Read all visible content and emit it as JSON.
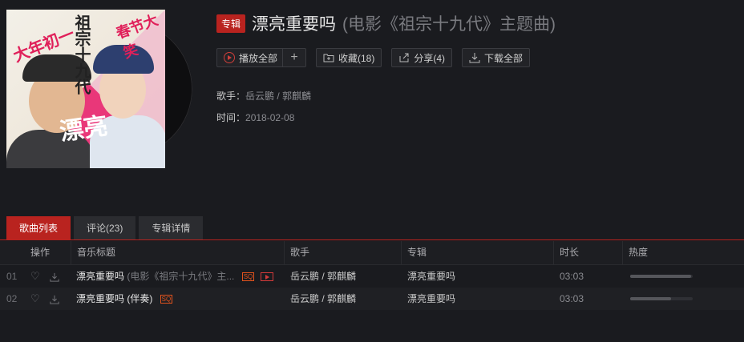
{
  "album": {
    "tag": "专辑",
    "name": "漂亮重要吗",
    "subtitle": "(电影《祖宗十九代》主题曲)",
    "artist_label": "歌手：",
    "artist": "岳云鹏 / 郭麒麟",
    "time_label": "时间：",
    "date": "2018-02-08",
    "cover_text": {
      "left": "大年初一",
      "right": "春节大笑",
      "top": "祖宗十九代",
      "center": "漂亮"
    }
  },
  "actions": {
    "play_all": "播放全部",
    "add": "+",
    "favorite": "收藏(18)",
    "share": "分享(4)",
    "download_all": "下载全部"
  },
  "tabs": [
    {
      "label": "歌曲列表",
      "active": true
    },
    {
      "label": "评论(23)",
      "active": false
    },
    {
      "label": "专辑详情",
      "active": false
    }
  ],
  "table": {
    "headers": {
      "ops": "操作",
      "title": "音乐标题",
      "artist": "歌手",
      "album": "专辑",
      "duration": "时长",
      "heat": "热度"
    },
    "rows": [
      {
        "num": "01",
        "title": "漂亮重要吗",
        "extra": "(电影《祖宗十九代》主...",
        "quality": "SQ",
        "has_mv": true,
        "artist": "岳云鹏 / 郭麒麟",
        "album": "漂亮重要吗",
        "duration": "03:03",
        "heat": 0.97
      },
      {
        "num": "02",
        "title": "漂亮重要吗 (伴奏)",
        "extra": "",
        "quality": "SQ",
        "has_mv": false,
        "artist": "岳云鹏 / 郭麒麟",
        "album": "漂亮重要吗",
        "duration": "03:03",
        "heat": 0.65
      }
    ]
  },
  "colors": {
    "accent": "#b9231f",
    "background": "#1a1b1f",
    "quality_badge": "#e0521d"
  }
}
